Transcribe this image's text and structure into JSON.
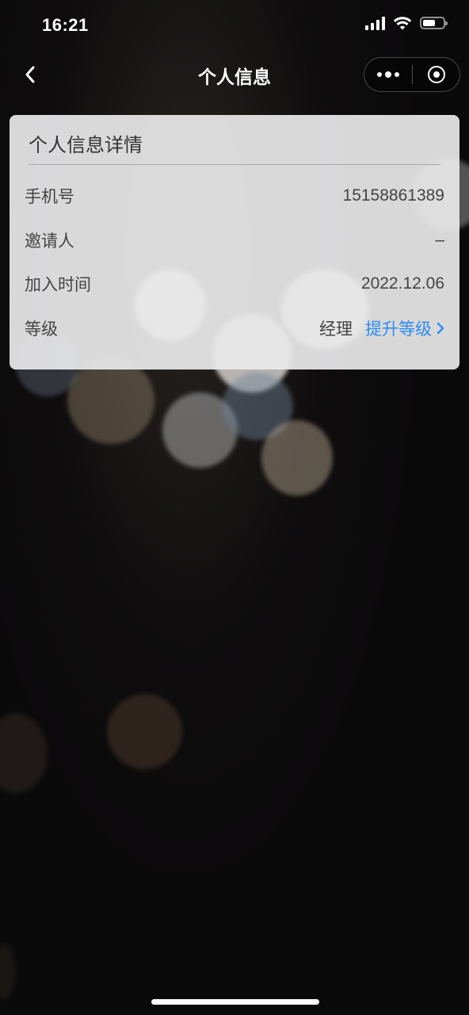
{
  "status_bar": {
    "time": "16:21",
    "icons": [
      "signal-icon",
      "wifi-icon",
      "battery-icon"
    ]
  },
  "nav": {
    "title": "个人信息",
    "back_icon": "chevron-left-icon",
    "more_icon": "more-dots-icon",
    "close_icon": "target-close-icon"
  },
  "card": {
    "title": "个人信息详情",
    "rows": [
      {
        "label": "手机号",
        "value": "15158861389"
      },
      {
        "label": "邀请人",
        "value": "–"
      },
      {
        "label": "加入时间",
        "value": "2022.12.06"
      },
      {
        "label": "等级",
        "value": "经理",
        "action": "提升等级"
      }
    ]
  },
  "colors": {
    "accent": "#2c8df0",
    "card_bg": "#e8e8ea",
    "background": "#0b0a0b"
  }
}
